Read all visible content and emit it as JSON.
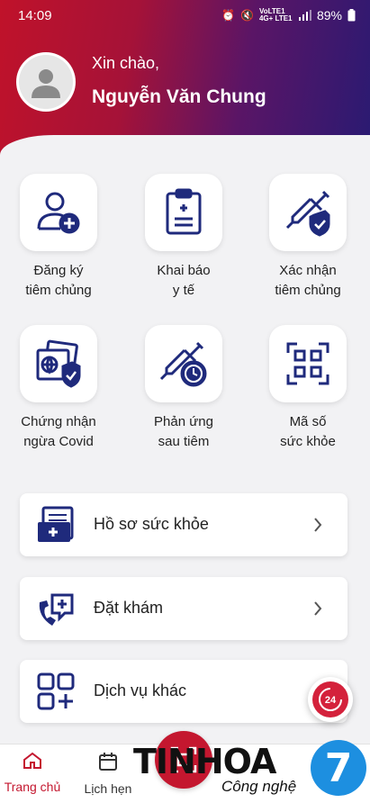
{
  "status": {
    "time": "14:09",
    "network": "VoLTE1 4G+ LTE1",
    "battery": "89%"
  },
  "user": {
    "greeting": "Xin chào,",
    "name": "Nguyễn Văn Chung"
  },
  "grid": {
    "items": [
      {
        "line1": "Đăng ký",
        "line2": "tiêm chủng",
        "icon": "register-person-icon"
      },
      {
        "line1": "Khai báo",
        "line2": "y tế",
        "icon": "medical-clipboard-icon"
      },
      {
        "line1": "Xác nhận",
        "line2": "tiêm chủng",
        "icon": "vaccine-shield-icon"
      },
      {
        "line1": "Chứng nhận",
        "line2": "ngừa Covid",
        "icon": "certificate-globe-icon"
      },
      {
        "line1": "Phản ứng",
        "line2": "sau tiêm",
        "icon": "syringe-clock-icon"
      },
      {
        "line1": "Mã số",
        "line2": "sức khỏe",
        "icon": "qr-code-icon"
      }
    ]
  },
  "cards": [
    {
      "label": "Hồ sơ sức khỏe",
      "icon": "health-record-icon"
    },
    {
      "label": "Đặt khám",
      "icon": "booking-phone-icon"
    },
    {
      "label": "Dịch vụ khác",
      "icon": "grid-plus-icon"
    }
  ],
  "hotline": {
    "label": "24"
  },
  "nav": {
    "home": "Trang chủ",
    "schedule": "Lịch hẹn"
  },
  "watermark": {
    "brand": "TINHOA",
    "sub": "Công nghệ",
    "logo": "7"
  },
  "colors": {
    "accent": "#c4172f",
    "icon_navy": "#1f2a7c",
    "header_start": "#c0122a",
    "header_end": "#2a1a72"
  }
}
